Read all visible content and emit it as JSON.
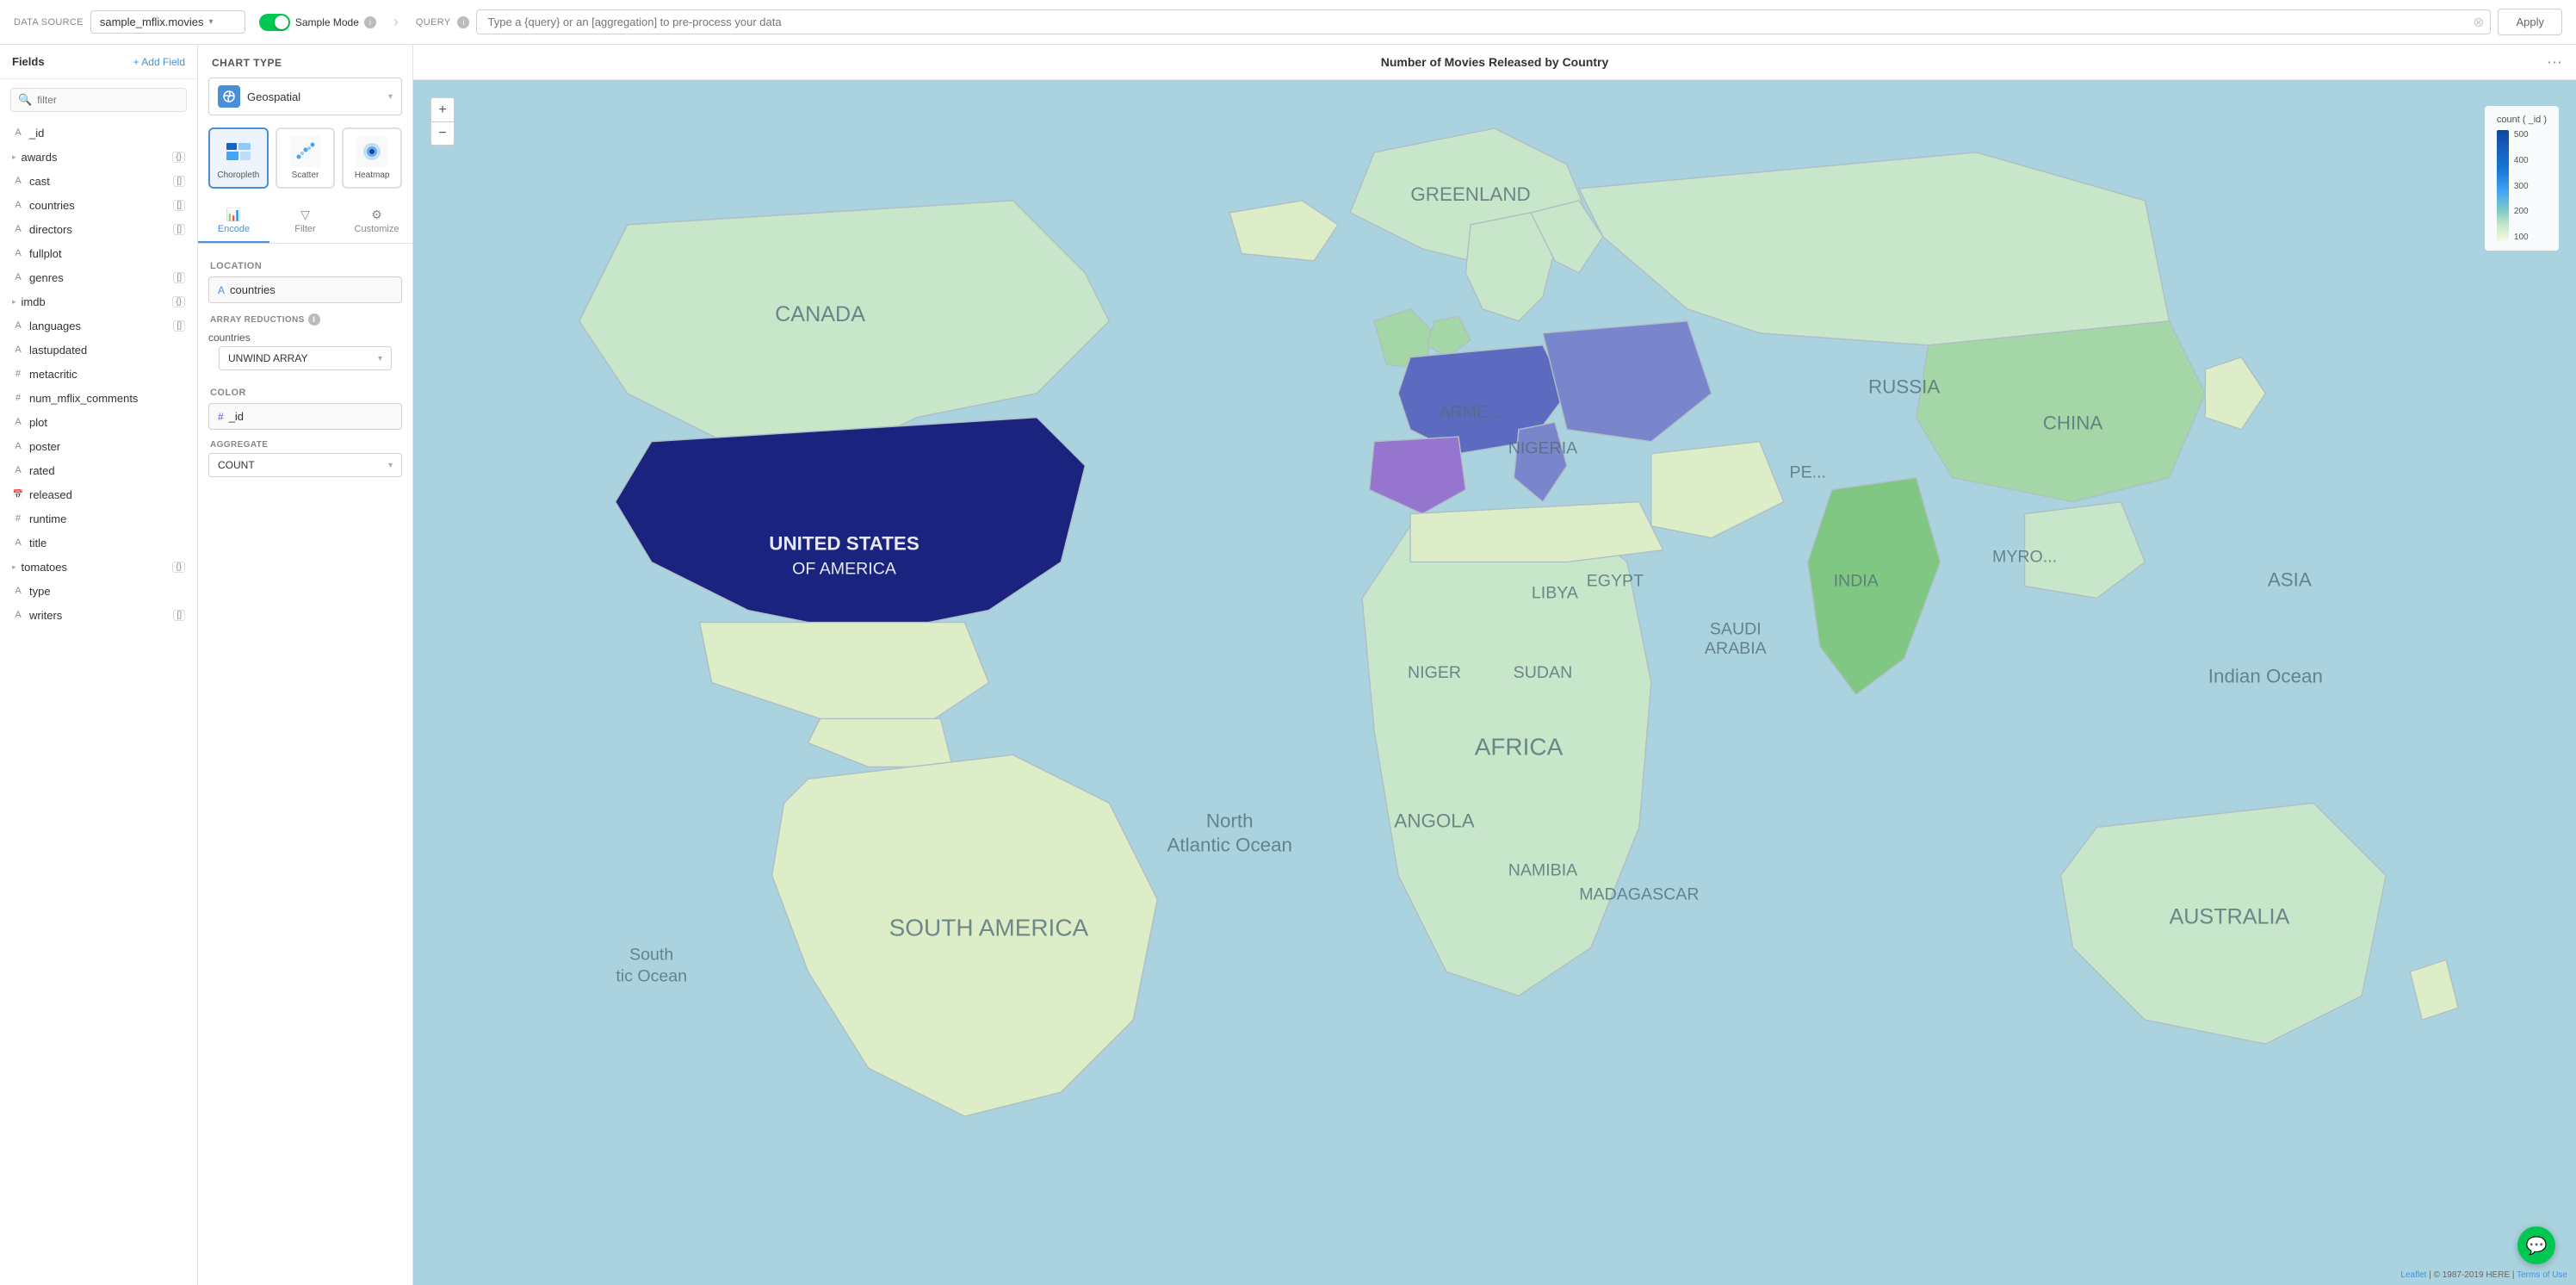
{
  "header": {
    "datasource_label": "Data Source",
    "datasource_value": "sample_mflix.movies",
    "sample_mode_label": "Sample Mode",
    "query_label": "Query",
    "query_placeholder": "Type a {query} or an [aggregation] to pre-process your data",
    "apply_label": "Apply",
    "info_icon": "i",
    "arrow_icon": "›"
  },
  "fields": {
    "title": "Fields",
    "add_label": "+ Add Field",
    "search_placeholder": "filter",
    "items": [
      {
        "type": "A",
        "name": "_id",
        "badge": ""
      },
      {
        "type": "expand",
        "name": "awards",
        "badge": "{}"
      },
      {
        "type": "A",
        "name": "cast",
        "badge": "[]"
      },
      {
        "type": "A",
        "name": "countries",
        "badge": "[]"
      },
      {
        "type": "A",
        "name": "directors",
        "badge": "[]"
      },
      {
        "type": "A",
        "name": "fullplot",
        "badge": ""
      },
      {
        "type": "A",
        "name": "genres",
        "badge": "[]"
      },
      {
        "type": "expand",
        "name": "imdb",
        "badge": "{}"
      },
      {
        "type": "A",
        "name": "languages",
        "badge": "[]"
      },
      {
        "type": "A",
        "name": "lastupdated",
        "badge": ""
      },
      {
        "type": "#",
        "name": "metacritic",
        "badge": ""
      },
      {
        "type": "#",
        "name": "num_mflix_comments",
        "badge": ""
      },
      {
        "type": "A",
        "name": "plot",
        "badge": ""
      },
      {
        "type": "A",
        "name": "poster",
        "badge": ""
      },
      {
        "type": "A",
        "name": "rated",
        "badge": ""
      },
      {
        "type": "cal",
        "name": "released",
        "badge": ""
      },
      {
        "type": "#",
        "name": "runtime",
        "badge": ""
      },
      {
        "type": "A",
        "name": "title",
        "badge": ""
      },
      {
        "type": "expand",
        "name": "tomatoes",
        "badge": "{}"
      },
      {
        "type": "A",
        "name": "type",
        "badge": ""
      },
      {
        "type": "A",
        "name": "writers",
        "badge": "[]"
      }
    ]
  },
  "chart_panel": {
    "chart_type_label": "Chart Type",
    "chart_type_name": "Geospatial",
    "subtypes": [
      {
        "label": "Choropleth",
        "active": true
      },
      {
        "label": "Scatter",
        "active": false
      },
      {
        "label": "Heatmap",
        "active": false
      }
    ],
    "tabs": [
      {
        "label": "Encode",
        "active": true
      },
      {
        "label": "Filter",
        "active": false
      },
      {
        "label": "Customize",
        "active": false
      }
    ],
    "location_label": "Location",
    "location_field": "countries",
    "array_reductions_label": "ARRAY REDUCTIONS",
    "reduction_field_name": "countries",
    "reduction_value": "UNWIND ARRAY",
    "color_label": "Color",
    "color_field": "_id",
    "aggregate_label": "AGGREGATE",
    "aggregate_value": "COUNT"
  },
  "map": {
    "title": "Number of Movies Released by Country",
    "zoom_in": "+",
    "zoom_out": "−",
    "legend_title": "count ( _id )",
    "legend_values": [
      "500",
      "400",
      "300",
      "200",
      "100"
    ],
    "attribution": "Leaflet | © 1987-2019 HERE | Terms of Use"
  },
  "chat": {
    "icon": "💬"
  }
}
